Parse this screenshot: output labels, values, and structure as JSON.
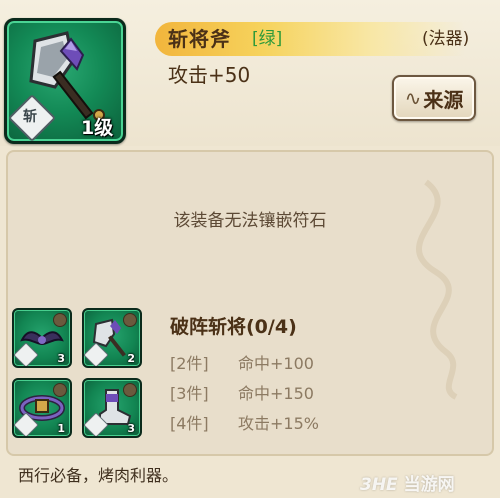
{
  "item": {
    "name": "斩将斧",
    "quality": "[绿]",
    "type": "(法器)",
    "attack": "攻击+50",
    "level": "1级",
    "rune_badge": "斩",
    "source_button": "来源"
  },
  "gem_notice": "该装备无法镶嵌符石",
  "set": {
    "title": "破阵斩将(0/4)",
    "pieces": [
      {
        "name": "wing-piece",
        "count": "3"
      },
      {
        "name": "axe-piece",
        "count": "2"
      },
      {
        "name": "belt-piece",
        "count": "1"
      },
      {
        "name": "boot-piece",
        "count": "3"
      }
    ],
    "bonuses": [
      {
        "count": "[2件]",
        "effect": "命中+100"
      },
      {
        "count": "[3件]",
        "effect": "命中+150"
      },
      {
        "count": "[4件]",
        "effect": "攻击+15%"
      }
    ]
  },
  "description": "西行必备，烤肉利器。",
  "watermark": {
    "logo": "3HE",
    "text": "当游网"
  },
  "colors": {
    "frame_green": "#138a56",
    "quality_green": "#2e9a3a",
    "banner_gold": "#f2b53c"
  }
}
